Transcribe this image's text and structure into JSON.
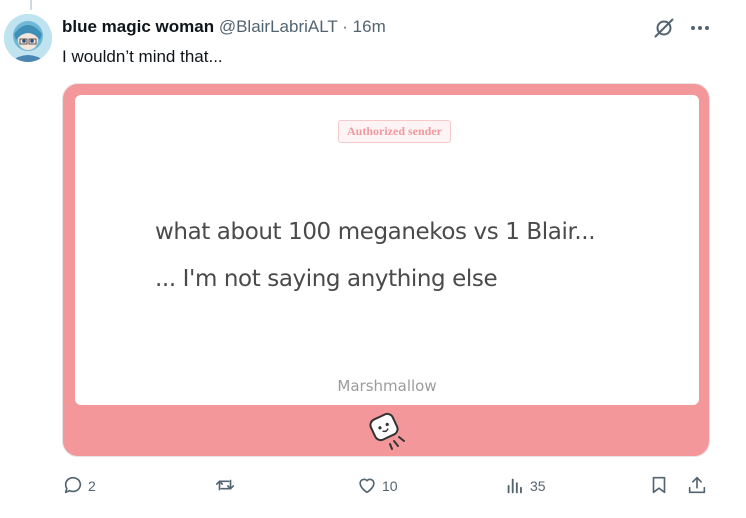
{
  "post": {
    "author_name": "blue magic woman",
    "author_handle": "@BlairLabriALT",
    "separator": "·",
    "time": "16m",
    "text": "I wouldn’t mind that..."
  },
  "media": {
    "badge": "Authorized sender",
    "message_line1": "what about 100 meganekos vs 1 Blair...",
    "message_line2": "... I'm not saying anything else",
    "brand": "Marshmallow"
  },
  "actions": {
    "reply_count": "2",
    "retweet_count": "",
    "like_count": "10",
    "views_count": "35"
  },
  "icons": [
    "grok-icon",
    "more-icon",
    "reply-icon",
    "retweet-icon",
    "like-icon",
    "views-icon",
    "bookmark-icon",
    "share-icon",
    "marshmallow-icon"
  ],
  "colors": {
    "media_bg": "#f3979b",
    "badge_text": "#ef9aa0",
    "secondary_text": "#536471"
  }
}
